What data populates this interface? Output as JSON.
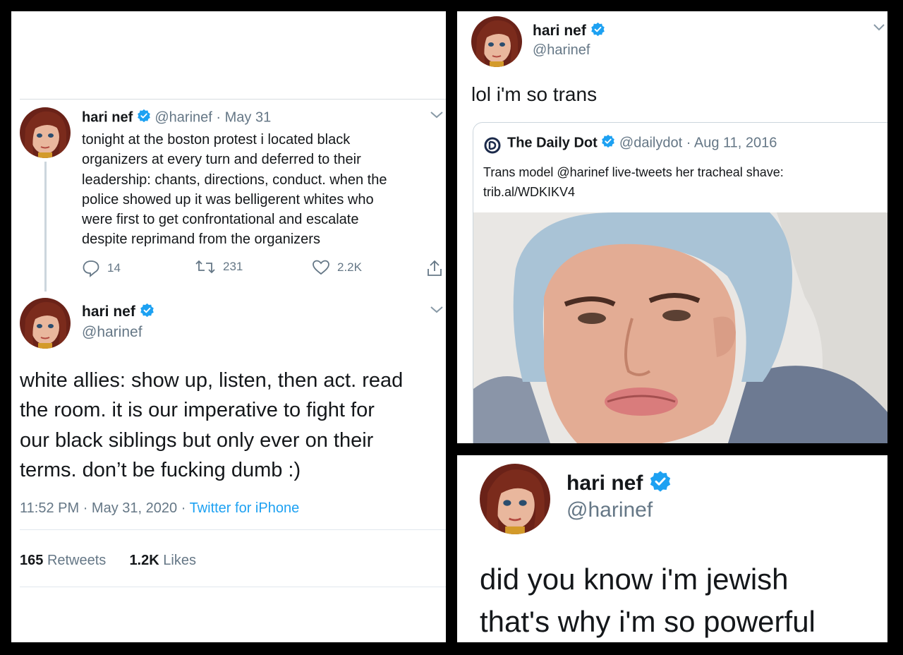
{
  "left": {
    "tweet1": {
      "name": "hari nef",
      "handle": "@harinef",
      "sep": "·",
      "date": "May 31",
      "lines": [
        "tonight at the boston protest i located black",
        "organizers at every turn and deferred to their",
        "leadership: chants, directions, conduct. when the",
        "police showed up it was belligerent whites who",
        "were first to get confrontational and escalate",
        "despite reprimand from the organizers"
      ],
      "replies": "14",
      "retweets": "231",
      "likes": "2.2K"
    },
    "tweet2": {
      "name": "hari nef",
      "handle": "@harinef",
      "lines": [
        "white allies: show up, listen, then act. read",
        "the room. it is our imperative to fight for",
        "our black siblings but only ever on their",
        "terms. don’t be fucking dumb :)"
      ],
      "time": "11:52 PM",
      "sep": "·",
      "date": "May 31, 2020",
      "source": "Twitter for iPhone",
      "retweet_count": "165",
      "retweet_label": "Retweets",
      "like_count": "1.2K",
      "like_label": "Likes"
    }
  },
  "top_right": {
    "name": "hari nef",
    "handle": "@harinef",
    "text": "lol i'm so trans",
    "quote": {
      "name": "The Daily Dot",
      "handle": "@dailydot",
      "sep": "·",
      "date": "Aug 11, 2016",
      "line1": "Trans model @harinef live-tweets her tracheal shave:",
      "line2": "trib.al/WDKIKV4"
    }
  },
  "bottom_right": {
    "name": "hari nef",
    "handle": "@harinef",
    "line1": "did you know i'm jewish",
    "line2": "that's why i'm so powerful"
  },
  "colors": {
    "accent": "#1da1f2",
    "muted": "#657786",
    "text": "#14171a",
    "verified": "#1da1f2"
  }
}
